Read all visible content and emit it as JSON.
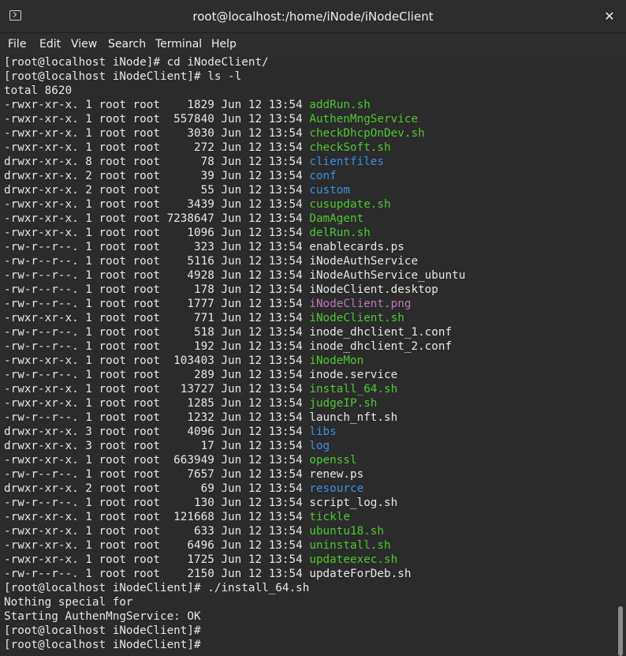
{
  "window": {
    "title": "root@localhost:/home/iNode/iNodeClient",
    "close_label": "✕"
  },
  "menu": [
    "File",
    "Edit",
    "View",
    "Search",
    "Terminal",
    "Help"
  ],
  "colors": {
    "executable": "#4ec732",
    "directory": "#3d8fe3",
    "image": "#b97bb8",
    "text": "#e6e6e6",
    "background": "#2b2b2b"
  },
  "terminal": {
    "lines_before": [
      "[root@localhost iNode]# cd iNodeClient/",
      "[root@localhost iNodeClient]# ls -l",
      "total 8620"
    ],
    "listing": [
      {
        "meta": "-rwxr-xr-x. 1 root root    1829 Jun 12 13:54 ",
        "name": "addRun.sh",
        "kind": "exec"
      },
      {
        "meta": "-rwxr-xr-x. 1 root root  557840 Jun 12 13:54 ",
        "name": "AuthenMngService",
        "kind": "exec"
      },
      {
        "meta": "-rwxr-xr-x. 1 root root    3030 Jun 12 13:54 ",
        "name": "checkDhcpOnDev.sh",
        "kind": "exec"
      },
      {
        "meta": "-rwxr-xr-x. 1 root root     272 Jun 12 13:54 ",
        "name": "checkSoft.sh",
        "kind": "exec"
      },
      {
        "meta": "drwxr-xr-x. 8 root root      78 Jun 12 13:54 ",
        "name": "clientfiles",
        "kind": "dir"
      },
      {
        "meta": "drwxr-xr-x. 2 root root      39 Jun 12 13:54 ",
        "name": "conf",
        "kind": "dir"
      },
      {
        "meta": "drwxr-xr-x. 2 root root      55 Jun 12 13:54 ",
        "name": "custom",
        "kind": "dir"
      },
      {
        "meta": "-rwxr-xr-x. 1 root root    3439 Jun 12 13:54 ",
        "name": "cusupdate.sh",
        "kind": "exec"
      },
      {
        "meta": "-rwxr-xr-x. 1 root root 7238647 Jun 12 13:54 ",
        "name": "DamAgent",
        "kind": "exec"
      },
      {
        "meta": "-rwxr-xr-x. 1 root root    1096 Jun 12 13:54 ",
        "name": "delRun.sh",
        "kind": "exec"
      },
      {
        "meta": "-rw-r--r--. 1 root root     323 Jun 12 13:54 ",
        "name": "enablecards.ps",
        "kind": "file"
      },
      {
        "meta": "-rw-r--r--. 1 root root    5116 Jun 12 13:54 ",
        "name": "iNodeAuthService",
        "kind": "file"
      },
      {
        "meta": "-rw-r--r--. 1 root root    4928 Jun 12 13:54 ",
        "name": "iNodeAuthService_ubuntu",
        "kind": "file"
      },
      {
        "meta": "-rw-r--r--. 1 root root     178 Jun 12 13:54 ",
        "name": "iNodeClient.desktop",
        "kind": "file"
      },
      {
        "meta": "-rw-r--r--. 1 root root    1777 Jun 12 13:54 ",
        "name": "iNodeClient.png",
        "kind": "img"
      },
      {
        "meta": "-rwxr-xr-x. 1 root root     771 Jun 12 13:54 ",
        "name": "iNodeClient.sh",
        "kind": "exec"
      },
      {
        "meta": "-rw-r--r--. 1 root root     518 Jun 12 13:54 ",
        "name": "inode_dhclient_1.conf",
        "kind": "file"
      },
      {
        "meta": "-rw-r--r--. 1 root root     192 Jun 12 13:54 ",
        "name": "inode_dhclient_2.conf",
        "kind": "file"
      },
      {
        "meta": "-rwxr-xr-x. 1 root root  103403 Jun 12 13:54 ",
        "name": "iNodeMon",
        "kind": "exec"
      },
      {
        "meta": "-rw-r--r--. 1 root root     289 Jun 12 13:54 ",
        "name": "inode.service",
        "kind": "file"
      },
      {
        "meta": "-rwxr-xr-x. 1 root root   13727 Jun 12 13:54 ",
        "name": "install_64.sh",
        "kind": "exec"
      },
      {
        "meta": "-rwxr-xr-x. 1 root root    1285 Jun 12 13:54 ",
        "name": "judgeIP.sh",
        "kind": "exec"
      },
      {
        "meta": "-rw-r--r--. 1 root root    1232 Jun 12 13:54 ",
        "name": "launch_nft.sh",
        "kind": "file"
      },
      {
        "meta": "drwxr-xr-x. 3 root root    4096 Jun 12 13:54 ",
        "name": "libs",
        "kind": "dir"
      },
      {
        "meta": "drwxr-xr-x. 3 root root      17 Jun 12 13:54 ",
        "name": "log",
        "kind": "dir"
      },
      {
        "meta": "-rwxr-xr-x. 1 root root  663949 Jun 12 13:54 ",
        "name": "openssl",
        "kind": "exec"
      },
      {
        "meta": "-rw-r--r--. 1 root root    7657 Jun 12 13:54 ",
        "name": "renew.ps",
        "kind": "file"
      },
      {
        "meta": "drwxr-xr-x. 2 root root      69 Jun 12 13:54 ",
        "name": "resource",
        "kind": "dir"
      },
      {
        "meta": "-rw-r--r--. 1 root root     130 Jun 12 13:54 ",
        "name": "script_log.sh",
        "kind": "file"
      },
      {
        "meta": "-rwxr-xr-x. 1 root root  121668 Jun 12 13:54 ",
        "name": "tickle",
        "kind": "exec"
      },
      {
        "meta": "-rwxr-xr-x. 1 root root     633 Jun 12 13:54 ",
        "name": "ubuntu18.sh",
        "kind": "exec"
      },
      {
        "meta": "-rwxr-xr-x. 1 root root    6496 Jun 12 13:54 ",
        "name": "uninstall.sh",
        "kind": "exec"
      },
      {
        "meta": "-rwxr-xr-x. 1 root root    1725 Jun 12 13:54 ",
        "name": "updateexec.sh",
        "kind": "exec"
      },
      {
        "meta": "-rw-r--r--. 1 root root    2150 Jun 12 13:54 ",
        "name": "updateForDeb.sh",
        "kind": "file"
      }
    ],
    "lines_after": [
      "[root@localhost iNodeClient]# ./install_64.sh",
      "Nothing special for",
      "Starting AuthenMngService: OK",
      "[root@localhost iNodeClient]#",
      "[root@localhost iNodeClient]#"
    ]
  }
}
